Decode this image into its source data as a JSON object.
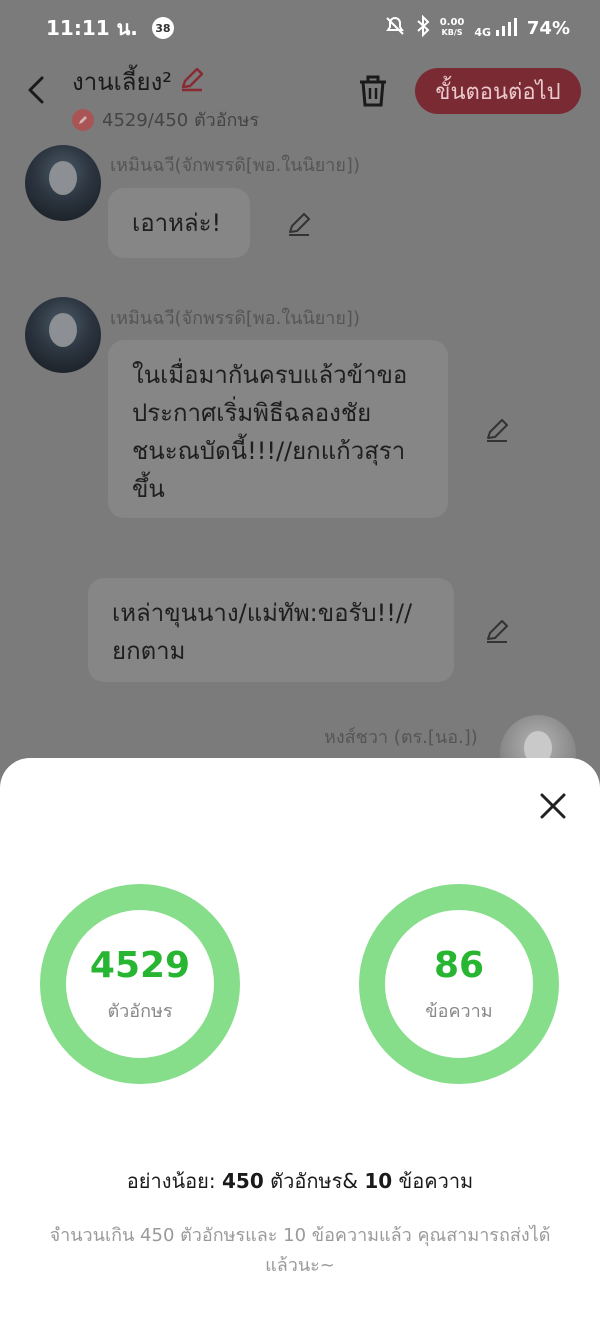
{
  "status_bar": {
    "time": "11:11 น.",
    "notif_count": "38",
    "net_speed": "0.00",
    "net_unit": "KB/S",
    "net_type": "4G",
    "battery": "74%"
  },
  "header": {
    "title": "งานเลี้ยง²",
    "char_count": "4529/450 ตัวอักษร",
    "next_label": "ขั้นตอนต่อไป"
  },
  "messages": [
    {
      "sender": "เหมินฉวี(จักพรรดิ[พอ.ในนิยาย])",
      "text": "เอาหล่ะ!"
    },
    {
      "sender": "เหมินฉวี(จักพรรดิ[พอ.ในนิยาย])",
      "text_lines": [
        "ในเมื่อมากันครบแล้วข้าขอ",
        "ประกาศเริ่มพิธีฉลองชัย",
        "ชนะณบัดนี้!!!//ยกแก้วสุรา",
        "ขึ้น"
      ]
    },
    {
      "text_lines": [
        "เหล่าขุนนาง/แม่ทัพ:ขอรับ!!//",
        "ยกตาม"
      ]
    },
    {
      "sender": "หงส์ชวา (ตร.[นอ.])"
    }
  ],
  "sheet": {
    "chars_value": "4529",
    "chars_label": "ตัวอักษร",
    "msgs_value": "86",
    "msgs_label": "ข้อความ",
    "minimum_prefix": "อย่างน้อย:",
    "minimum_chars": "450",
    "minimum_chars_label": "ตัวอักษร&",
    "minimum_msgs": "10",
    "minimum_msgs_label": "ข้อความ",
    "note": "จำนวนเกิน 450 ตัวอักษรและ 10 ข้อความแล้ว คุณสามารถส่งได้แล้วนะ~"
  },
  "colors": {
    "ring": "#86dd8a",
    "ring_text": "#27b532",
    "next_button": "#7a2a33"
  }
}
